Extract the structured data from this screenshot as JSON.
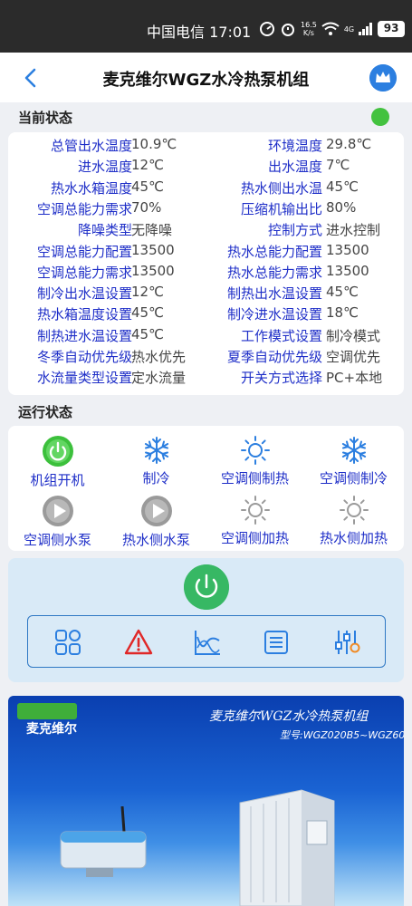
{
  "status_bar": {
    "carrier_time": "中国电信 17:01",
    "net_speed_value": "16.5",
    "net_speed_unit": "K/s",
    "network": "4G",
    "battery": "93"
  },
  "header": {
    "title": "麦克维尔WGZ水冷热泵机组"
  },
  "current_status": {
    "label": "当前状态",
    "online_color": "#43c23f",
    "rows": [
      {
        "l1": "总管出水温度",
        "v1": "10.9℃",
        "l2": "环境温度",
        "v2": "29.8℃"
      },
      {
        "l1": "进水温度",
        "v1": "12℃",
        "l2": "出水温度",
        "v2": "7℃"
      },
      {
        "l1": "热水水箱温度",
        "v1": "45℃",
        "l2": "热水侧出水温",
        "v2": "45℃"
      },
      {
        "l1": "空调总能力需求",
        "v1": "70%",
        "l2": "压缩机输出比",
        "v2": "80%"
      },
      {
        "l1": "降噪类型",
        "v1": "无降噪",
        "l2": "控制方式",
        "v2": "进水控制"
      },
      {
        "l1": "空调总能力配置",
        "v1": "13500",
        "l2": "热水总能力配置",
        "v2": "13500"
      },
      {
        "l1": "空调总能力需求",
        "v1": "13500",
        "l2": "热水总能力需求",
        "v2": "13500"
      },
      {
        "l1": "制冷出水温设置",
        "v1": "12℃",
        "l2": "制热出水温设置",
        "v2": "45℃"
      },
      {
        "l1": "热水箱温度设置",
        "v1": "45℃",
        "l2": "制冷进水温设置",
        "v2": "18℃"
      },
      {
        "l1": "制热进水温设置",
        "v1": "45℃",
        "l2": "工作模式设置",
        "v2": "制冷模式"
      },
      {
        "l1": "冬季自动优先级",
        "v1": "热水优先",
        "l2": "夏季自动优先级",
        "v2": "空调优先"
      },
      {
        "l1": "水流量类型设置",
        "v1": "定水流量",
        "l2": "开关方式选择",
        "v2": "PC+本地"
      }
    ]
  },
  "run_status": {
    "label": "运行状态",
    "items": [
      {
        "label": "机组开机",
        "icon": "power-on-icon",
        "active": true
      },
      {
        "label": "制冷",
        "icon": "snowflake-icon",
        "active": true
      },
      {
        "label": "空调侧制热",
        "icon": "sun-icon",
        "active": true
      },
      {
        "label": "空调侧制冷",
        "icon": "snowflake-icon",
        "active": true
      },
      {
        "label": "空调侧水泵",
        "icon": "pump-icon",
        "active": false
      },
      {
        "label": "热水侧水泵",
        "icon": "pump-icon",
        "active": false
      },
      {
        "label": "空调侧加热",
        "icon": "sun-icon",
        "active": false
      },
      {
        "label": "热水侧加热",
        "icon": "sun-icon",
        "active": false
      }
    ]
  },
  "controls": {
    "power_color": "#37b864",
    "tools": [
      "grid-icon",
      "alarm-warning-icon",
      "curve-chart-icon",
      "list-icon",
      "settings-sliders-icon"
    ]
  },
  "banner": {
    "brand_logo": "McQuay International",
    "brand_name": "麦克维尔",
    "title": "麦克维尔WGZ水冷热泵机组",
    "model": "型号:WGZ020B5~WGZ60B5"
  }
}
